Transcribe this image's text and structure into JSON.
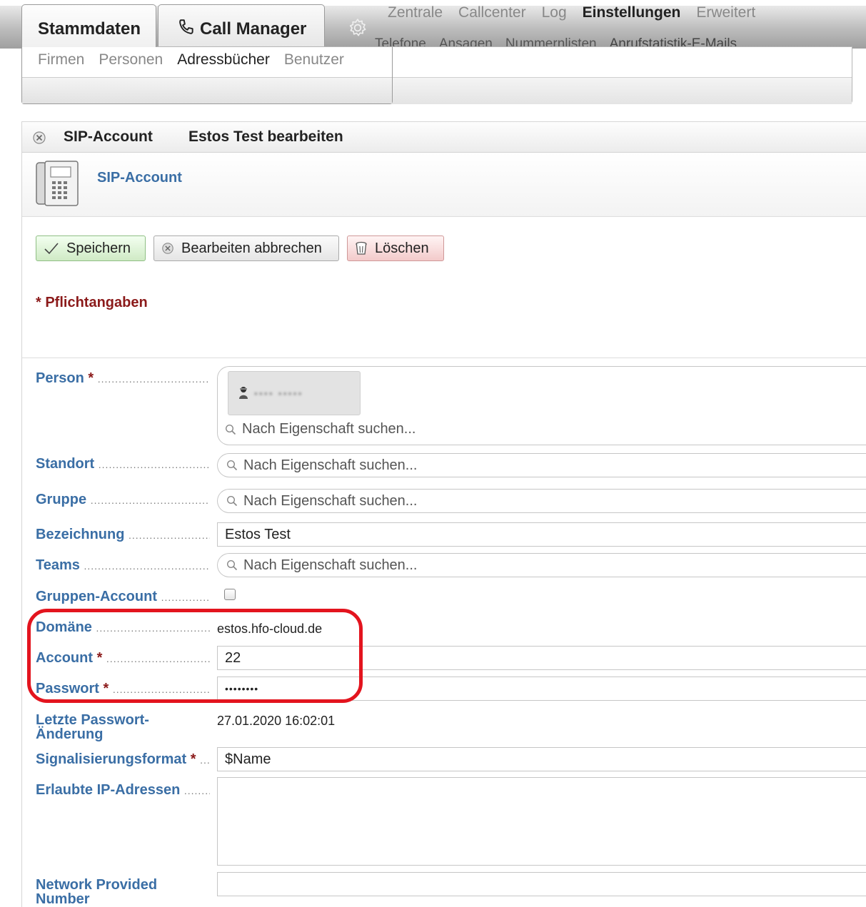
{
  "tabs": {
    "stammdaten": "Stammdaten",
    "call_manager": "Call Manager"
  },
  "stamm_menu": [
    "Firmen",
    "Personen",
    "Adressbücher",
    "Benutzer"
  ],
  "call_menu": [
    "Zentrale",
    "Callcenter",
    "Log",
    "Einstellungen",
    "Erweitert"
  ],
  "call_submenu": [
    "Telefone",
    "Ansagen",
    "Nummernlisten",
    "Anrufstatistik-E-Mails"
  ],
  "panel": {
    "type": "SIP-Account",
    "title": "Estos Test bearbeiten",
    "section": "SIP-Account"
  },
  "buttons": {
    "save": "Speichern",
    "cancel": "Bearbeiten abbrechen",
    "delete": "Löschen"
  },
  "required_note": "* Pflichtangaben",
  "search_placeholder": "Nach Eigenschaft suchen...",
  "fields": {
    "person": "Person",
    "standort": "Standort",
    "gruppe": "Gruppe",
    "bezeichnung": "Bezeichnung",
    "bezeichnung_value": "Estos Test",
    "teams": "Teams",
    "gruppen_account": "Gruppen-Account",
    "domaene": "Domäne",
    "domaene_value": "estos.hfo-cloud.de",
    "account": "Account",
    "account_value": "22",
    "passwort": "Passwort",
    "passwort_value": "••••••••",
    "letzte_pw": "Letzte Passwort-Änderung",
    "letzte_pw_value": "27.01.2020 16:02:01",
    "signal": "Signalisierungsformat",
    "signal_value": "$Name",
    "erlaubte_ip": "Erlaubte IP-Adressen",
    "npn": "Network Provided Number"
  },
  "colors": {
    "label_blue": "#3a6ea5",
    "required_red": "#8b1a1a",
    "highlight_red": "#e3141e"
  }
}
